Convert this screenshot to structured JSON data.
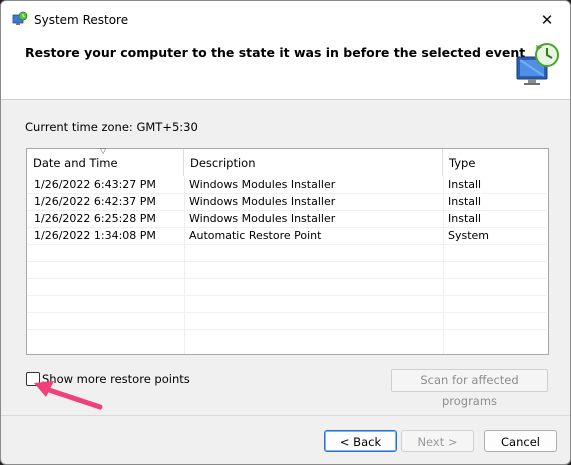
{
  "window": {
    "title": "System Restore",
    "close_glyph": "✕",
    "header_title": "Restore your computer to the state it was in before the selected event",
    "header_icon": "system-restore-icon"
  },
  "timezone_label": "Current time zone: GMT+5:30",
  "table": {
    "columns": [
      "Date and Time",
      "Description",
      "Type"
    ],
    "sort_indicator": "▽",
    "rows": [
      {
        "date": "1/26/2022 6:43:27 PM",
        "description": "Windows Modules Installer",
        "type": "Install"
      },
      {
        "date": "1/26/2022 6:42:37 PM",
        "description": "Windows Modules Installer",
        "type": "Install"
      },
      {
        "date": "1/26/2022 6:25:28 PM",
        "description": "Windows Modules Installer",
        "type": "Install"
      },
      {
        "date": "1/26/2022 1:34:08 PM",
        "description": "Automatic Restore Point",
        "type": "System"
      }
    ]
  },
  "options": {
    "show_more_label": "Show more restore points",
    "show_more_checked": false,
    "scan_label": "Scan for affected programs"
  },
  "buttons": {
    "back": "< Back",
    "next": "Next >",
    "cancel": "Cancel"
  },
  "annotation_color": "#f0407a"
}
